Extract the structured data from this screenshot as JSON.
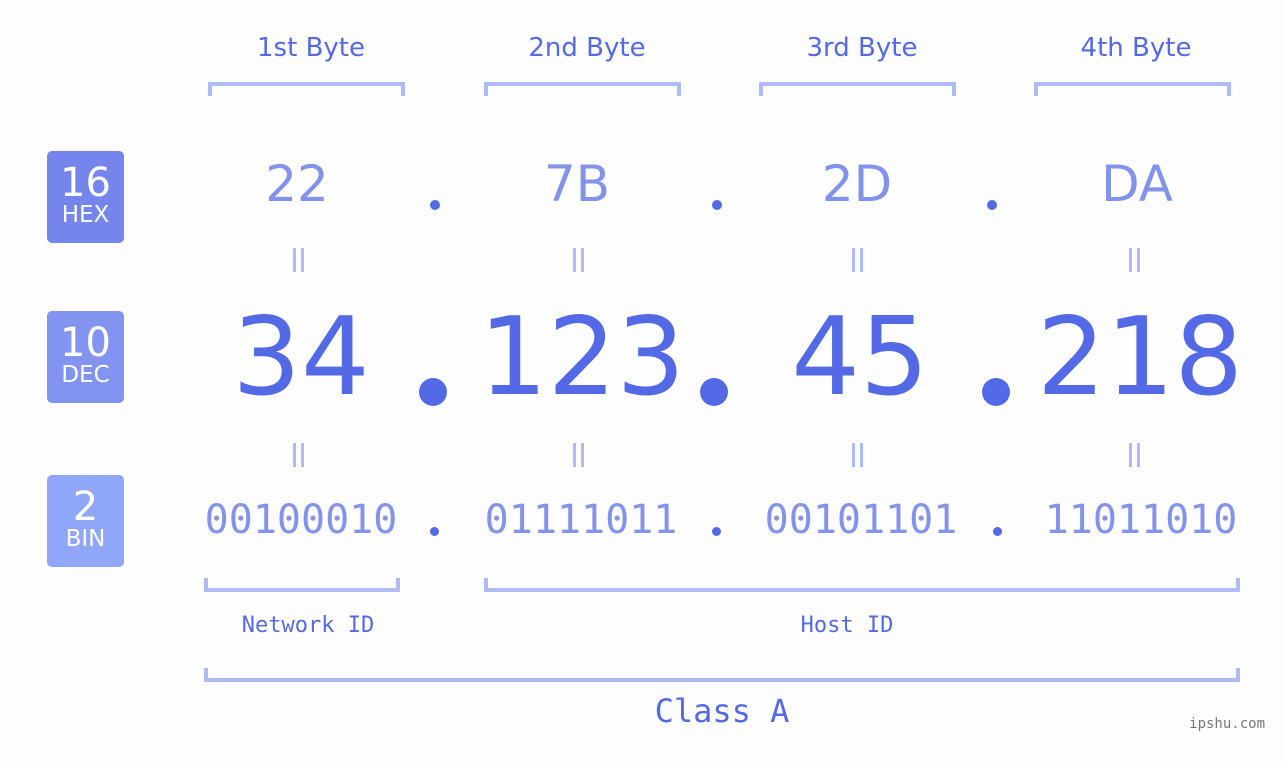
{
  "byte_headers": [
    "1st Byte",
    "2nd Byte",
    "3rd Byte",
    "4th Byte"
  ],
  "rows": {
    "hex": {
      "base": "16",
      "label": "HEX",
      "color": "#7585ec",
      "values": [
        "22",
        "7B",
        "2D",
        "DA"
      ]
    },
    "dec": {
      "base": "10",
      "label": "DEC",
      "color": "#8394f0",
      "values": [
        "34",
        "123",
        "45",
        "218"
      ]
    },
    "bin": {
      "base": "2",
      "label": "BIN",
      "color": "#90a6f8",
      "values": [
        "00100010",
        "01111011",
        "00101101",
        "11011010"
      ]
    }
  },
  "ip_address": "34.123.45.218",
  "network_id_label": "Network ID",
  "host_id_label": "Host ID",
  "class_label": "Class A",
  "watermark": "ipshu.com",
  "colors": {
    "accent": "#5469e6",
    "light_accent": "#8392ec",
    "bracket": "#b0bbf5"
  }
}
